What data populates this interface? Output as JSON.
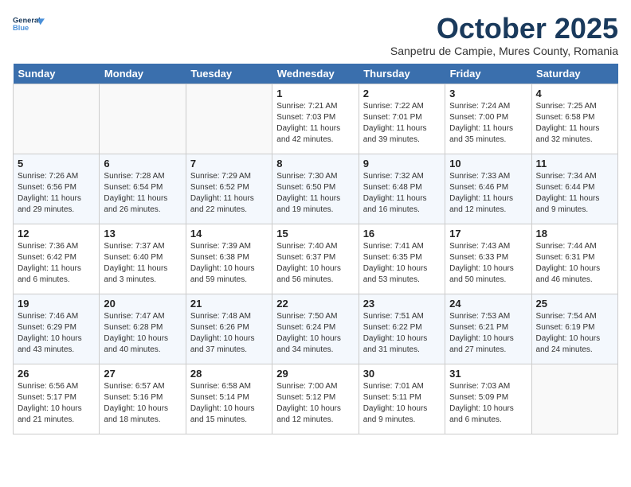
{
  "header": {
    "logo_line1": "General",
    "logo_line2": "Blue",
    "month": "October 2025",
    "location": "Sanpetru de Campie, Mures County, Romania"
  },
  "weekdays": [
    "Sunday",
    "Monday",
    "Tuesday",
    "Wednesday",
    "Thursday",
    "Friday",
    "Saturday"
  ],
  "weeks": [
    [
      {
        "day": "",
        "info": ""
      },
      {
        "day": "",
        "info": ""
      },
      {
        "day": "",
        "info": ""
      },
      {
        "day": "1",
        "info": "Sunrise: 7:21 AM\nSunset: 7:03 PM\nDaylight: 11 hours\nand 42 minutes."
      },
      {
        "day": "2",
        "info": "Sunrise: 7:22 AM\nSunset: 7:01 PM\nDaylight: 11 hours\nand 39 minutes."
      },
      {
        "day": "3",
        "info": "Sunrise: 7:24 AM\nSunset: 7:00 PM\nDaylight: 11 hours\nand 35 minutes."
      },
      {
        "day": "4",
        "info": "Sunrise: 7:25 AM\nSunset: 6:58 PM\nDaylight: 11 hours\nand 32 minutes."
      }
    ],
    [
      {
        "day": "5",
        "info": "Sunrise: 7:26 AM\nSunset: 6:56 PM\nDaylight: 11 hours\nand 29 minutes."
      },
      {
        "day": "6",
        "info": "Sunrise: 7:28 AM\nSunset: 6:54 PM\nDaylight: 11 hours\nand 26 minutes."
      },
      {
        "day": "7",
        "info": "Sunrise: 7:29 AM\nSunset: 6:52 PM\nDaylight: 11 hours\nand 22 minutes."
      },
      {
        "day": "8",
        "info": "Sunrise: 7:30 AM\nSunset: 6:50 PM\nDaylight: 11 hours\nand 19 minutes."
      },
      {
        "day": "9",
        "info": "Sunrise: 7:32 AM\nSunset: 6:48 PM\nDaylight: 11 hours\nand 16 minutes."
      },
      {
        "day": "10",
        "info": "Sunrise: 7:33 AM\nSunset: 6:46 PM\nDaylight: 11 hours\nand 12 minutes."
      },
      {
        "day": "11",
        "info": "Sunrise: 7:34 AM\nSunset: 6:44 PM\nDaylight: 11 hours\nand 9 minutes."
      }
    ],
    [
      {
        "day": "12",
        "info": "Sunrise: 7:36 AM\nSunset: 6:42 PM\nDaylight: 11 hours\nand 6 minutes."
      },
      {
        "day": "13",
        "info": "Sunrise: 7:37 AM\nSunset: 6:40 PM\nDaylight: 11 hours\nand 3 minutes."
      },
      {
        "day": "14",
        "info": "Sunrise: 7:39 AM\nSunset: 6:38 PM\nDaylight: 10 hours\nand 59 minutes."
      },
      {
        "day": "15",
        "info": "Sunrise: 7:40 AM\nSunset: 6:37 PM\nDaylight: 10 hours\nand 56 minutes."
      },
      {
        "day": "16",
        "info": "Sunrise: 7:41 AM\nSunset: 6:35 PM\nDaylight: 10 hours\nand 53 minutes."
      },
      {
        "day": "17",
        "info": "Sunrise: 7:43 AM\nSunset: 6:33 PM\nDaylight: 10 hours\nand 50 minutes."
      },
      {
        "day": "18",
        "info": "Sunrise: 7:44 AM\nSunset: 6:31 PM\nDaylight: 10 hours\nand 46 minutes."
      }
    ],
    [
      {
        "day": "19",
        "info": "Sunrise: 7:46 AM\nSunset: 6:29 PM\nDaylight: 10 hours\nand 43 minutes."
      },
      {
        "day": "20",
        "info": "Sunrise: 7:47 AM\nSunset: 6:28 PM\nDaylight: 10 hours\nand 40 minutes."
      },
      {
        "day": "21",
        "info": "Sunrise: 7:48 AM\nSunset: 6:26 PM\nDaylight: 10 hours\nand 37 minutes."
      },
      {
        "day": "22",
        "info": "Sunrise: 7:50 AM\nSunset: 6:24 PM\nDaylight: 10 hours\nand 34 minutes."
      },
      {
        "day": "23",
        "info": "Sunrise: 7:51 AM\nSunset: 6:22 PM\nDaylight: 10 hours\nand 31 minutes."
      },
      {
        "day": "24",
        "info": "Sunrise: 7:53 AM\nSunset: 6:21 PM\nDaylight: 10 hours\nand 27 minutes."
      },
      {
        "day": "25",
        "info": "Sunrise: 7:54 AM\nSunset: 6:19 PM\nDaylight: 10 hours\nand 24 minutes."
      }
    ],
    [
      {
        "day": "26",
        "info": "Sunrise: 6:56 AM\nSunset: 5:17 PM\nDaylight: 10 hours\nand 21 minutes."
      },
      {
        "day": "27",
        "info": "Sunrise: 6:57 AM\nSunset: 5:16 PM\nDaylight: 10 hours\nand 18 minutes."
      },
      {
        "day": "28",
        "info": "Sunrise: 6:58 AM\nSunset: 5:14 PM\nDaylight: 10 hours\nand 15 minutes."
      },
      {
        "day": "29",
        "info": "Sunrise: 7:00 AM\nSunset: 5:12 PM\nDaylight: 10 hours\nand 12 minutes."
      },
      {
        "day": "30",
        "info": "Sunrise: 7:01 AM\nSunset: 5:11 PM\nDaylight: 10 hours\nand 9 minutes."
      },
      {
        "day": "31",
        "info": "Sunrise: 7:03 AM\nSunset: 5:09 PM\nDaylight: 10 hours\nand 6 minutes."
      },
      {
        "day": "",
        "info": ""
      }
    ]
  ]
}
